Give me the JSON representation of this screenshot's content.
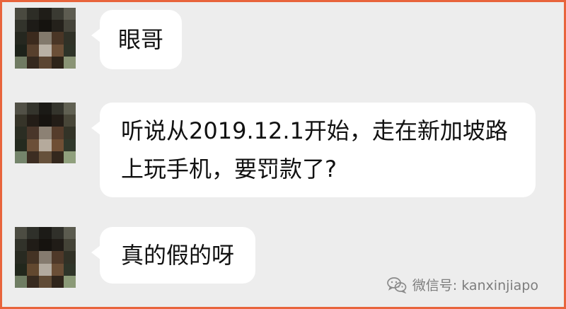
{
  "colors": {
    "frame_border": "#e8643c",
    "chat_background": "#ededed",
    "bubble": "#ffffff"
  },
  "messages": [
    {
      "text": "眼哥",
      "avatar_icon": "pixelated-avatar-icon"
    },
    {
      "text": "听说从2019.12.1开始，走在新加坡路上玩手机，要罚款了?",
      "avatar_icon": "pixelated-avatar-icon"
    },
    {
      "text": "真的假的呀",
      "avatar_icon": "pixelated-avatar-icon"
    }
  ],
  "watermark": {
    "icon": "wechat-icon",
    "text": "微信号: kanxinjiapo"
  }
}
